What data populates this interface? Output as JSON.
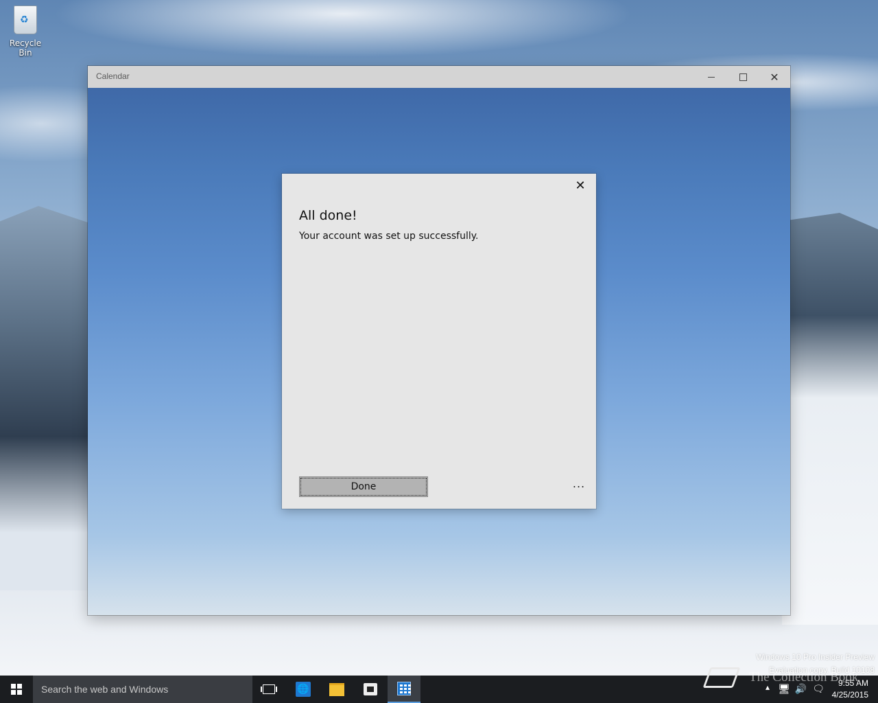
{
  "desktop": {
    "icons": [
      {
        "label": "Recycle Bin",
        "icon": "recycle-bin-icon"
      }
    ]
  },
  "window": {
    "title": "Calendar",
    "controls": {
      "minimize": "minimize-icon",
      "maximize": "maximize-icon",
      "close": "close-icon"
    }
  },
  "dialog": {
    "heading": "All done!",
    "message": "Your account was set up successfully.",
    "primary_button": "Done",
    "close_icon": "close-icon",
    "more_label": "..."
  },
  "watermark": {
    "line1": "Windows 10 Pro Insider Preview",
    "line2": "Evaluation copy. Build 10108"
  },
  "overlay_logo": {
    "text": "The Collection Book"
  },
  "taskbar": {
    "search_placeholder": "Search the web and Windows",
    "pinned": [
      {
        "name": "task-view",
        "icon": "task-view-icon"
      },
      {
        "name": "internet-explorer",
        "icon": "internet-explorer-icon"
      },
      {
        "name": "file-explorer",
        "icon": "folder-icon"
      },
      {
        "name": "store",
        "icon": "store-icon"
      },
      {
        "name": "calendar",
        "icon": "calendar-icon",
        "active": true
      }
    ],
    "clock": {
      "time": "9:55 AM",
      "date": "4/25/2015"
    }
  },
  "colors": {
    "accent": "#1e78d0",
    "taskbar": "#1b1d20",
    "dialog_bg": "#e6e6e6",
    "titlebar": "#d4d4d4"
  }
}
